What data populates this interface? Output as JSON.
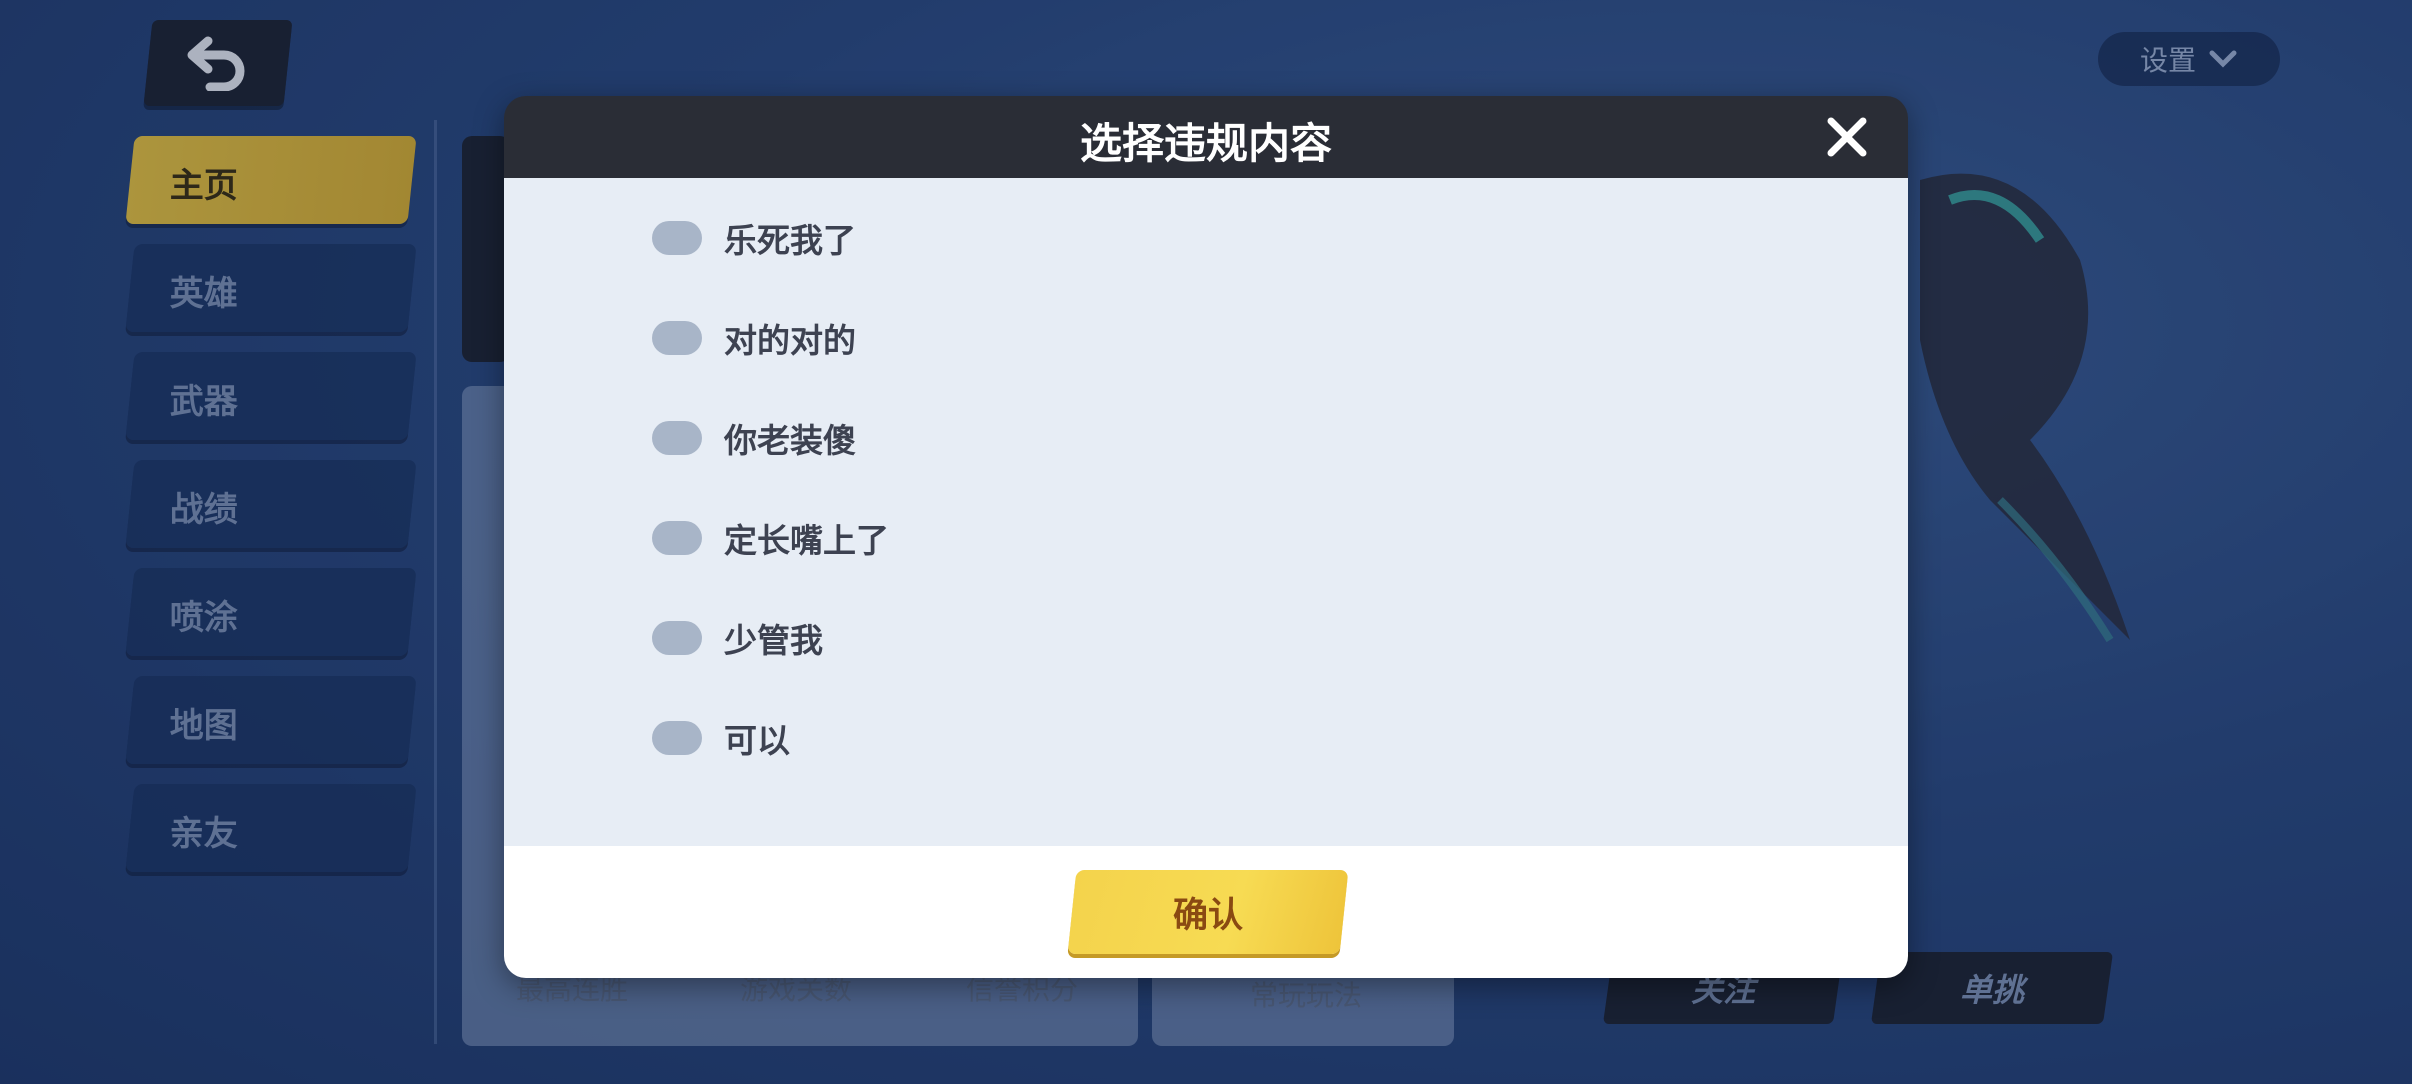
{
  "sidebar": {
    "items": [
      {
        "label": "主页",
        "active": true
      },
      {
        "label": "英雄"
      },
      {
        "label": "武器"
      },
      {
        "label": "战绩"
      },
      {
        "label": "喷涂"
      },
      {
        "label": "地图"
      },
      {
        "label": "亲友"
      }
    ]
  },
  "header": {
    "back_icon": "undo-arrow-icon",
    "settings_label": "设置",
    "settings_icon": "chevron-down-icon"
  },
  "background": {
    "stats": [
      "最高连胜",
      "游戏关数",
      "信誉积分"
    ],
    "common_mode_label": "常玩玩法",
    "follow_label": "关注",
    "duel_label": "单挑"
  },
  "dialog": {
    "title": "选择违规内容",
    "close_icon": "close-icon",
    "options": [
      {
        "label": "乐死我了",
        "checked": false
      },
      {
        "label": "对的对的",
        "checked": false
      },
      {
        "label": "你老装傻",
        "checked": false
      },
      {
        "label": "定长嘴上了",
        "checked": false
      },
      {
        "label": "少管我",
        "checked": false
      },
      {
        "label": "可以",
        "checked": false
      }
    ],
    "confirm_label": "确认"
  },
  "colors": {
    "accent_yellow": "#f4d34c",
    "header_dark": "#2a2d36",
    "body_light": "#e7edf5",
    "toggle_off": "#a8b5c8"
  }
}
